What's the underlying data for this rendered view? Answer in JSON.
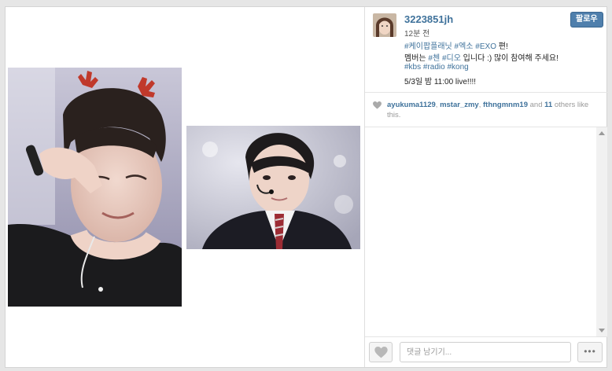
{
  "post": {
    "username": "3223851jh",
    "follow_label": "팔로우",
    "time": "12분 전",
    "caption": {
      "line1": [
        {
          "text": "#케이팝플래닛",
          "tag": true
        },
        {
          "text": " ",
          "tag": false
        },
        {
          "text": "#엑소",
          "tag": true
        },
        {
          "text": " ",
          "tag": false
        },
        {
          "text": "#EXO",
          "tag": true
        },
        {
          "text": " 편!",
          "tag": false
        }
      ],
      "line2": [
        {
          "text": "멤버는 ",
          "tag": false
        },
        {
          "text": "#첸",
          "tag": true
        },
        {
          "text": " ",
          "tag": false
        },
        {
          "text": "#디오",
          "tag": true
        },
        {
          "text": " 입니다 :) 많이 참여해 주세요!",
          "tag": false
        }
      ],
      "line3": [
        {
          "text": "#kbs",
          "tag": true
        },
        {
          "text": " ",
          "tag": false
        },
        {
          "text": "#radio",
          "tag": true
        },
        {
          "text": " ",
          "tag": false
        },
        {
          "text": "#kong",
          "tag": true
        }
      ],
      "line4": "5/3일 밤 11:00 live!!!!"
    }
  },
  "likes": {
    "users": [
      "ayukuma1129",
      "mstar_zmy",
      "fthngmnm19"
    ],
    "and_word": "and",
    "count": "11",
    "suffix": "others like this."
  },
  "comment_box": {
    "placeholder": "댓글 남기기...",
    "more_label": "•••"
  },
  "colors": {
    "link": "#3f729b",
    "follow_bg": "#4f7fac"
  },
  "icons": {
    "like": "heart-icon",
    "more": "ellipsis-icon"
  }
}
